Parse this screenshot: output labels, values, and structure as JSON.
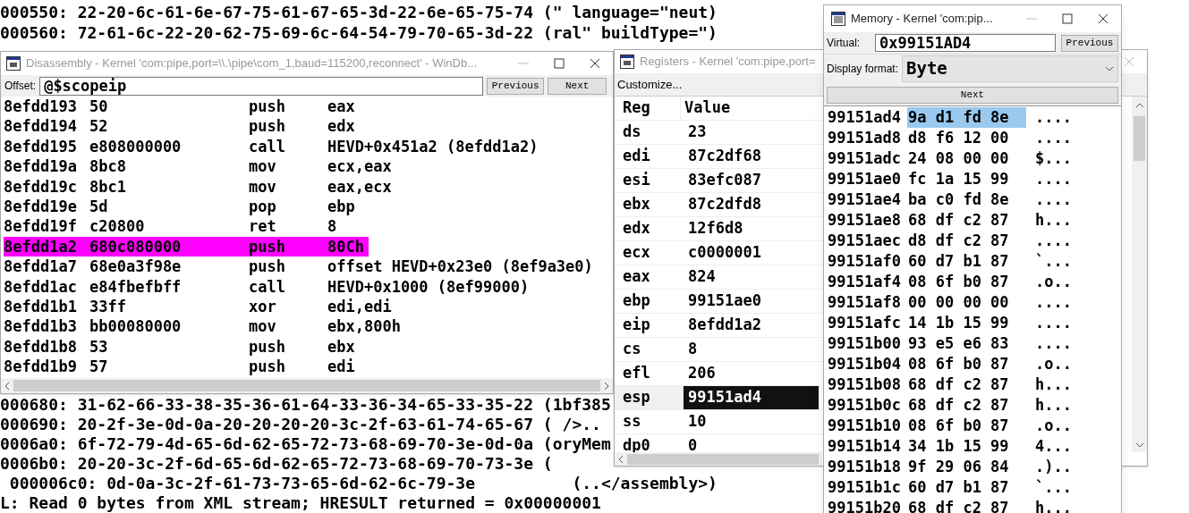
{
  "console": {
    "top_lines": [
      "000550: 22-20-6c-61-6e-67-75-61-67-65-3d-22-6e-65-75-74 (\" language=\"neut)",
      "000560: 72-61-6c-22-20-62-75-69-6c-64-54-79-70-65-3d-22 (ral\" buildType=\")"
    ],
    "bottom_lines": [
      "000680: 31-62-66-33-38-35-36-61-64-33-36-34-65-33-35-22 (1bf385",
      "000690: 20-2f-3e-0d-0a-20-20-20-20-3c-2f-63-61-74-65-67 ( />..",
      "0006a0: 6f-72-79-4d-65-6d-62-65-72-73-68-69-70-3e-0d-0a (oryMem",
      "0006b0: 20-20-3c-2f-6d-65-6d-62-65-72-73-68-69-70-73-3e (",
      " 000006c0: 0d-0a-3c-2f-61-73-73-65-6d-62-6c-79-3e          (..</assembly>)",
      "L: Read 0 bytes from XML stream; HRESULT returned = 0x00000001"
    ]
  },
  "disassembly": {
    "title": "Disassembly - Kernel 'com:pipe,port=\\\\.\\pipe\\com_1,baud=115200,reconnect' - WinDb...",
    "offset_label": "Offset:",
    "offset_value": "@$scopeip",
    "buttons": [
      "Previous",
      "Next"
    ],
    "rows": [
      {
        "address": "8efdd193",
        "bytes": "50",
        "mnemonic": "push",
        "operands": "eax",
        "current": false
      },
      {
        "address": "8efdd194",
        "bytes": "52",
        "mnemonic": "push",
        "operands": "edx",
        "current": false
      },
      {
        "address": "8efdd195",
        "bytes": "e808000000",
        "mnemonic": "call",
        "operands": "HEVD+0x451a2 (8efdd1a2)",
        "current": false
      },
      {
        "address": "8efdd19a",
        "bytes": "8bc8",
        "mnemonic": "mov",
        "operands": "ecx,eax",
        "current": false
      },
      {
        "address": "8efdd19c",
        "bytes": "8bc1",
        "mnemonic": "mov",
        "operands": "eax,ecx",
        "current": false
      },
      {
        "address": "8efdd19e",
        "bytes": "5d",
        "mnemonic": "pop",
        "operands": "ebp",
        "current": false
      },
      {
        "address": "8efdd19f",
        "bytes": "c20800",
        "mnemonic": "ret",
        "operands": "8",
        "current": false
      },
      {
        "address": "8efdd1a2",
        "bytes": "680c080000",
        "mnemonic": "push",
        "operands": "80Ch",
        "current": true
      },
      {
        "address": "8efdd1a7",
        "bytes": "68e0a3f98e",
        "mnemonic": "push",
        "operands": "offset HEVD+0x23e0 (8ef9a3e0)",
        "current": false
      },
      {
        "address": "8efdd1ac",
        "bytes": "e84fbefbff",
        "mnemonic": "call",
        "operands": "HEVD+0x1000 (8ef99000)",
        "current": false
      },
      {
        "address": "8efdd1b1",
        "bytes": "33ff",
        "mnemonic": "xor",
        "operands": "edi,edi",
        "current": false
      },
      {
        "address": "8efdd1b3",
        "bytes": "bb00080000",
        "mnemonic": "mov",
        "operands": "ebx,800h",
        "current": false
      },
      {
        "address": "8efdd1b8",
        "bytes": "53",
        "mnemonic": "push",
        "operands": "ebx",
        "current": false
      },
      {
        "address": "8efdd1b9",
        "bytes": "57",
        "mnemonic": "push",
        "operands": "edi",
        "current": false
      }
    ]
  },
  "registers": {
    "title": "Registers - Kernel 'com:pipe,port=",
    "customize": "Customize...",
    "columns": [
      "Reg",
      "Value"
    ],
    "rows": [
      {
        "name": "ds",
        "value": "23",
        "selected": false
      },
      {
        "name": "edi",
        "value": "87c2df68",
        "selected": false
      },
      {
        "name": "esi",
        "value": "83efc087",
        "selected": false
      },
      {
        "name": "ebx",
        "value": "87c2dfd8",
        "selected": false
      },
      {
        "name": "edx",
        "value": "12f6d8",
        "selected": false
      },
      {
        "name": "ecx",
        "value": "c0000001",
        "selected": false
      },
      {
        "name": "eax",
        "value": "824",
        "selected": false
      },
      {
        "name": "ebp",
        "value": "99151ae0",
        "selected": false
      },
      {
        "name": "eip",
        "value": "8efdd1a2",
        "selected": false
      },
      {
        "name": "cs",
        "value": "8",
        "selected": false
      },
      {
        "name": "efl",
        "value": "206",
        "selected": false
      },
      {
        "name": "esp",
        "value": "99151ad4",
        "selected": true
      },
      {
        "name": "ss",
        "value": "10",
        "selected": false
      },
      {
        "name": "dp0",
        "value": "0",
        "selected": false
      }
    ]
  },
  "memory": {
    "title": "Memory - Kernel 'com:pip...",
    "virtual_label": "Virtual:",
    "virtual_value": "0x99151AD4",
    "previous_button": "Previous",
    "format_label": "Display format:",
    "format_value": "Byte",
    "next_button": "Next",
    "rows": [
      {
        "address": "99151ad4",
        "bytes": "9a d1 fd 8e",
        "ascii": "....",
        "selected": true
      },
      {
        "address": "99151ad8",
        "bytes": "d8 f6 12 00",
        "ascii": "....",
        "selected": false
      },
      {
        "address": "99151adc",
        "bytes": "24 08 00 00",
        "ascii": "$...",
        "selected": false
      },
      {
        "address": "99151ae0",
        "bytes": "fc 1a 15 99",
        "ascii": "....",
        "selected": false
      },
      {
        "address": "99151ae4",
        "bytes": "ba c0 fd 8e",
        "ascii": "....",
        "selected": false
      },
      {
        "address": "99151ae8",
        "bytes": "68 df c2 87",
        "ascii": "h...",
        "selected": false
      },
      {
        "address": "99151aec",
        "bytes": "d8 df c2 87",
        "ascii": "....",
        "selected": false
      },
      {
        "address": "99151af0",
        "bytes": "60 d7 b1 87",
        "ascii": "`...",
        "selected": false
      },
      {
        "address": "99151af4",
        "bytes": "08 6f b0 87",
        "ascii": ".o..",
        "selected": false
      },
      {
        "address": "99151af8",
        "bytes": "00 00 00 00",
        "ascii": "....",
        "selected": false
      },
      {
        "address": "99151afc",
        "bytes": "14 1b 15 99",
        "ascii": "....",
        "selected": false
      },
      {
        "address": "99151b00",
        "bytes": "93 e5 e6 83",
        "ascii": "....",
        "selected": false
      },
      {
        "address": "99151b04",
        "bytes": "08 6f b0 87",
        "ascii": ".o..",
        "selected": false
      },
      {
        "address": "99151b08",
        "bytes": "68 df c2 87",
        "ascii": "h...",
        "selected": false
      },
      {
        "address": "99151b0c",
        "bytes": "68 df c2 87",
        "ascii": "h...",
        "selected": false
      },
      {
        "address": "99151b10",
        "bytes": "08 6f b0 87",
        "ascii": ".o..",
        "selected": false
      },
      {
        "address": "99151b14",
        "bytes": "34 1b 15 99",
        "ascii": "4...",
        "selected": false
      },
      {
        "address": "99151b18",
        "bytes": "9f 29 06 84",
        "ascii": ".)..",
        "selected": false
      },
      {
        "address": "99151b1c",
        "bytes": "60 d7 b1 87",
        "ascii": "`...",
        "selected": false
      },
      {
        "address": "99151b20",
        "bytes": "68 df c2 87",
        "ascii": "h...",
        "selected": false
      }
    ]
  }
}
